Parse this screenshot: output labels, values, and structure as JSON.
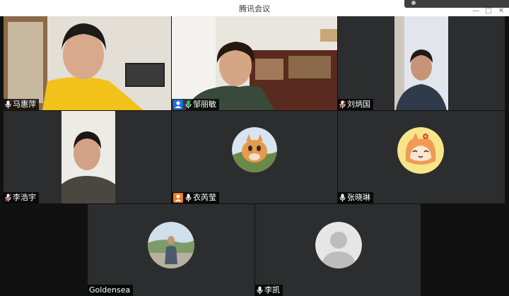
{
  "window": {
    "title": "腾讯会议"
  },
  "participants": [
    {
      "name": "马惠萍"
    },
    {
      "name": "邹丽敏"
    },
    {
      "name": "刘炳国"
    },
    {
      "name": "李浩宇"
    },
    {
      "name": "衣芮莹"
    },
    {
      "name": "张晓琳"
    },
    {
      "name": "Goldensea"
    },
    {
      "name": "李凯"
    }
  ],
  "colors": {
    "tile_bg": "#2c2d2f",
    "accent_blue": "#1e6fe0",
    "accent_orange": "#f07b1f",
    "label_bg": "#000000"
  }
}
